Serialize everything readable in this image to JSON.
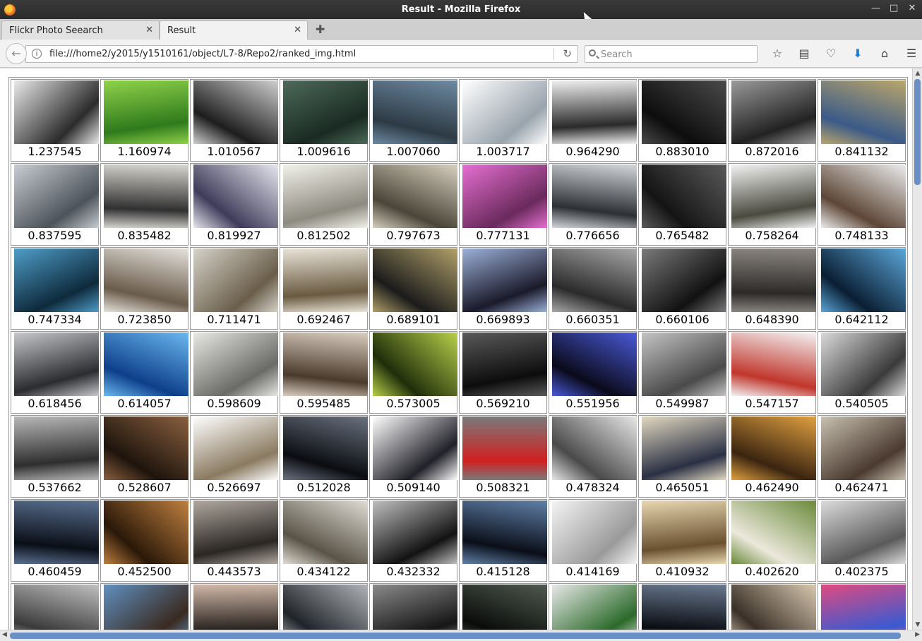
{
  "window": {
    "title": "Result - Mozilla Firefox"
  },
  "tabs": [
    {
      "label": "Flickr Photo Seearch",
      "active": false
    },
    {
      "label": "Result",
      "active": true
    }
  ],
  "navbar": {
    "url": "file:///home2/y2015/y1510161/object/L7-8/Repo2/ranked_img.html",
    "search_placeholder": "Search"
  },
  "results": [
    {
      "score": "1.237545",
      "colors": [
        "#e9e9e9",
        "#2b2b2b"
      ]
    },
    {
      "score": "1.160974",
      "colors": [
        "#8fd24a",
        "#2f7a1c"
      ]
    },
    {
      "score": "1.010567",
      "colors": [
        "#cfcfcf",
        "#1d1d1d"
      ]
    },
    {
      "score": "1.009616",
      "colors": [
        "#4c6a5a",
        "#1a2a22"
      ]
    },
    {
      "score": "1.007060",
      "colors": [
        "#6d8aa3",
        "#2d3a44"
      ]
    },
    {
      "score": "1.003717",
      "colors": [
        "#ffffff",
        "#9aa4ad"
      ]
    },
    {
      "score": "0.964290",
      "colors": [
        "#f0f0f0",
        "#2a2a2a"
      ]
    },
    {
      "score": "0.883010",
      "colors": [
        "#4a4a4a",
        "#0d0d0d"
      ]
    },
    {
      "score": "0.872016",
      "colors": [
        "#9a9a9a",
        "#222222"
      ]
    },
    {
      "score": "0.841132",
      "colors": [
        "#bba66b",
        "#3a5a88"
      ]
    },
    {
      "score": "0.837595",
      "colors": [
        "#c8cdd2",
        "#4c535a"
      ]
    },
    {
      "score": "0.835482",
      "colors": [
        "#d8d6d0",
        "#303030"
      ]
    },
    {
      "score": "0.819927",
      "colors": [
        "#e6e6ee",
        "#3e3c5a"
      ]
    },
    {
      "score": "0.812502",
      "colors": [
        "#f2f2ea",
        "#8d8a80"
      ]
    },
    {
      "score": "0.797673",
      "colors": [
        "#d7d0c0",
        "#4a4538"
      ]
    },
    {
      "score": "0.777131",
      "colors": [
        "#e66fd2",
        "#6a2a5c"
      ]
    },
    {
      "score": "0.776656",
      "colors": [
        "#d4d8dc",
        "#2c3034"
      ]
    },
    {
      "score": "0.765482",
      "colors": [
        "#5a5a5a",
        "#141414"
      ]
    },
    {
      "score": "0.758264",
      "colors": [
        "#f2f2f2",
        "#4a4a40"
      ]
    },
    {
      "score": "0.748133",
      "colors": [
        "#ececec",
        "#5d4636"
      ]
    },
    {
      "score": "0.747334",
      "colors": [
        "#4f9dc8",
        "#0e2a3c"
      ]
    },
    {
      "score": "0.723850",
      "colors": [
        "#e4e2dc",
        "#6a5b4a"
      ]
    },
    {
      "score": "0.711471",
      "colors": [
        "#d5d2c9",
        "#6a5e4a"
      ]
    },
    {
      "score": "0.692467",
      "colors": [
        "#e9e4d8",
        "#6a5a40"
      ]
    },
    {
      "score": "0.689101",
      "colors": [
        "#b0a06a",
        "#1b1b1b"
      ]
    },
    {
      "score": "0.669893",
      "colors": [
        "#9cb0d8",
        "#1a1a2a"
      ]
    },
    {
      "score": "0.660351",
      "colors": [
        "#a8a8a8",
        "#2a2a2a"
      ]
    },
    {
      "score": "0.660106",
      "colors": [
        "#7a7a7a",
        "#111111"
      ]
    },
    {
      "score": "0.648390",
      "colors": [
        "#8a8580",
        "#2c2a28"
      ]
    },
    {
      "score": "0.642112",
      "colors": [
        "#5ba6d8",
        "#0a1e33"
      ]
    },
    {
      "score": "0.618456",
      "colors": [
        "#c6c8cc",
        "#2a2c30"
      ]
    },
    {
      "score": "0.614057",
      "colors": [
        "#6ab8f0",
        "#0e3f8a"
      ]
    },
    {
      "score": "0.598609",
      "colors": [
        "#e8e8e4",
        "#6a6a66"
      ]
    },
    {
      "score": "0.595485",
      "colors": [
        "#d9cdbf",
        "#4a3a2c"
      ]
    },
    {
      "score": "0.573005",
      "colors": [
        "#b8d04a",
        "#1f2e0a"
      ]
    },
    {
      "score": "0.569210",
      "colors": [
        "#5a5a5a",
        "#0c0c0c"
      ]
    },
    {
      "score": "0.551956",
      "colors": [
        "#4a5ad8",
        "#0a0a1a"
      ]
    },
    {
      "score": "0.549987",
      "colors": [
        "#c4c4c4",
        "#4a4a4a"
      ]
    },
    {
      "score": "0.547157",
      "colors": [
        "#f4f4f4",
        "#c0362c"
      ]
    },
    {
      "score": "0.540505",
      "colors": [
        "#dadada",
        "#3a3a3a"
      ]
    },
    {
      "score": "0.537662",
      "colors": [
        "#b8b8b8",
        "#2e2e2e"
      ]
    },
    {
      "score": "0.528607",
      "colors": [
        "#8a6040",
        "#1e140c"
      ]
    },
    {
      "score": "0.526697",
      "colors": [
        "#ffffff",
        "#8a7a60"
      ]
    },
    {
      "score": "0.512028",
      "colors": [
        "#6a7280",
        "#0a0c10"
      ]
    },
    {
      "score": "0.509140",
      "colors": [
        "#ffffff",
        "#202028"
      ]
    },
    {
      "score": "0.508321",
      "colors": [
        "#7a7a7a",
        "#d02020"
      ]
    },
    {
      "score": "0.478324",
      "colors": [
        "#e6e6e6",
        "#4a4a4a"
      ]
    },
    {
      "score": "0.465051",
      "colors": [
        "#e2d8c0",
        "#2a3044"
      ]
    },
    {
      "score": "0.462490",
      "colors": [
        "#e0a040",
        "#3a2410"
      ]
    },
    {
      "score": "0.462471",
      "colors": [
        "#c8c0b0",
        "#4a3a30"
      ]
    },
    {
      "score": "0.460459",
      "colors": [
        "#5a7090",
        "#0a0e16"
      ]
    },
    {
      "score": "0.452500",
      "colors": [
        "#c08040",
        "#2a1808"
      ]
    },
    {
      "score": "0.443573",
      "colors": [
        "#b0a8a0",
        "#2a2622"
      ]
    },
    {
      "score": "0.434122",
      "colors": [
        "#e0dcd4",
        "#5a5448"
      ]
    },
    {
      "score": "0.432332",
      "colors": [
        "#c0c0c0",
        "#121212"
      ]
    },
    {
      "score": "0.415128",
      "colors": [
        "#6080a8",
        "#0a0e18"
      ]
    },
    {
      "score": "0.414169",
      "colors": [
        "#f4f4f4",
        "#9a9a9a"
      ]
    },
    {
      "score": "0.410932",
      "colors": [
        "#e8d8b0",
        "#6a5030"
      ]
    },
    {
      "score": "0.402620",
      "colors": [
        "#6a8a3a",
        "#ece8dc"
      ]
    },
    {
      "score": "0.402375",
      "colors": [
        "#dcdcdc",
        "#5a5a5a"
      ]
    },
    {
      "score": "",
      "colors": [
        "#c0c0c0",
        "#3a3a3a"
      ]
    },
    {
      "score": "",
      "colors": [
        "#6090c0",
        "#3a2a20"
      ]
    },
    {
      "score": "",
      "colors": [
        "#d0b8a8",
        "#2a2420"
      ]
    },
    {
      "score": "",
      "colors": [
        "#b0b4b8",
        "#202428"
      ]
    },
    {
      "score": "",
      "colors": [
        "#8a8a8a",
        "#161616"
      ]
    },
    {
      "score": "",
      "colors": [
        "#505a50",
        "#0a0c0a"
      ]
    },
    {
      "score": "",
      "colors": [
        "#e8e8e8",
        "#2a6a2a"
      ]
    },
    {
      "score": "",
      "colors": [
        "#6a7a90",
        "#0a0c12"
      ]
    },
    {
      "score": "",
      "colors": [
        "#d8c8b0",
        "#3a3028"
      ]
    },
    {
      "score": "",
      "colors": [
        "#e04a80",
        "#3a5ad0"
      ]
    }
  ]
}
